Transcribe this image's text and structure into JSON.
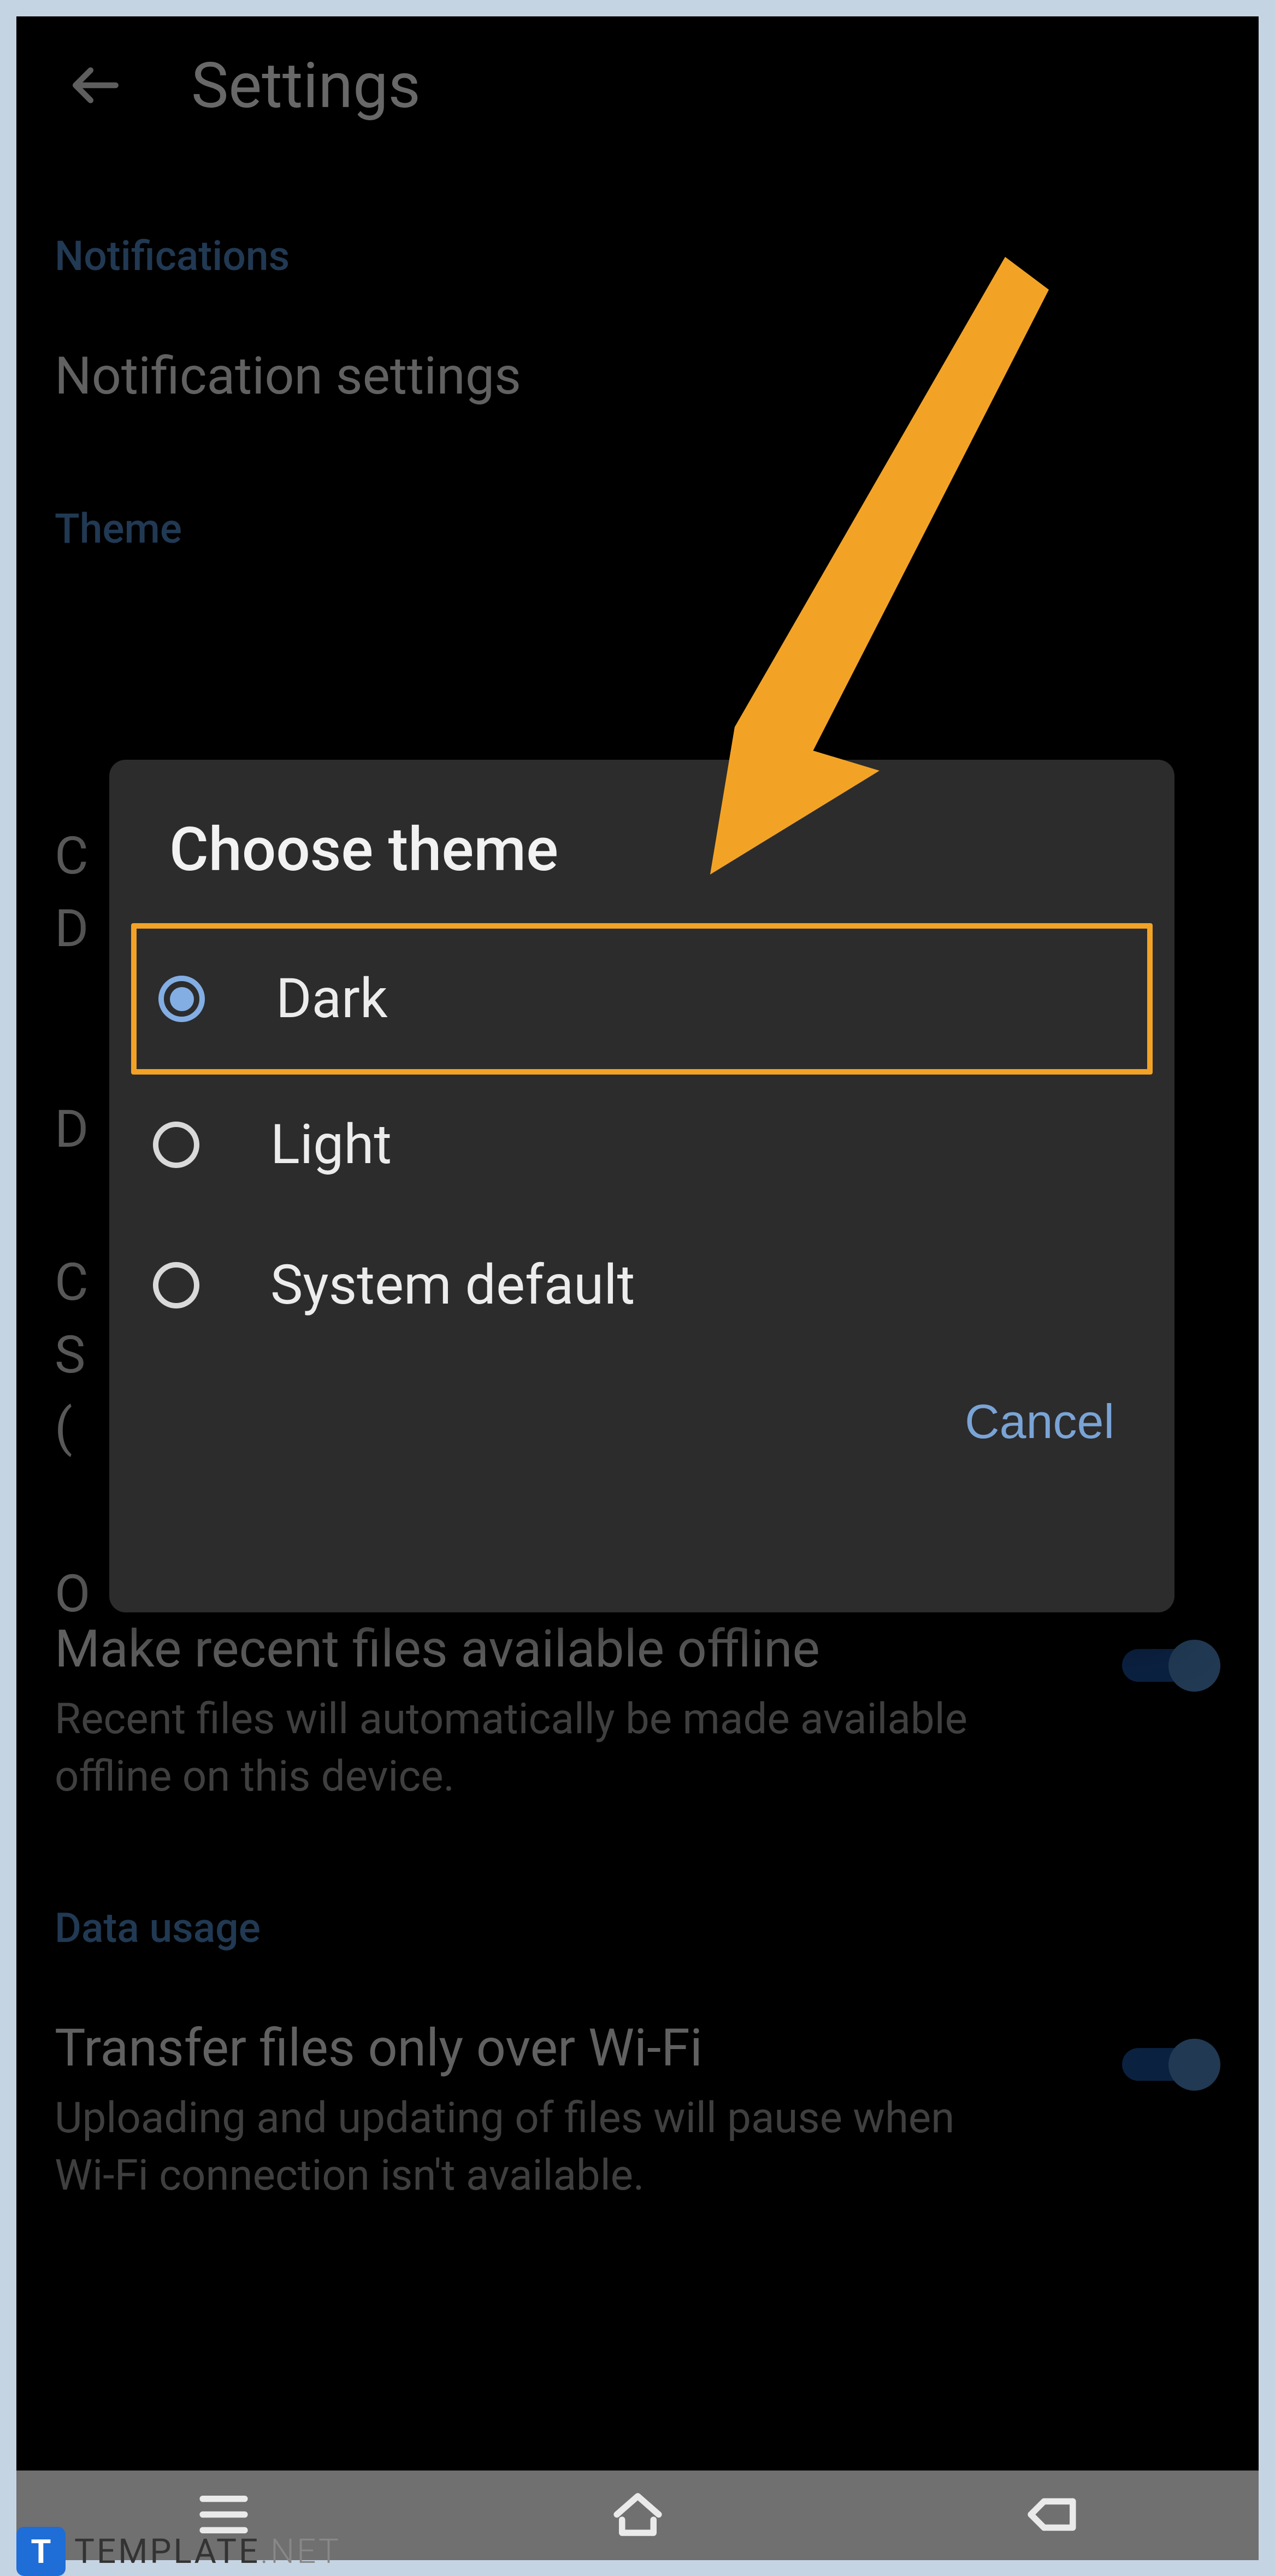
{
  "header": {
    "title": "Settings"
  },
  "sections": {
    "notifications": {
      "label": "Notifications",
      "row1": "Notification settings"
    },
    "theme": {
      "label": "Theme"
    },
    "offline": {
      "title": "Make recent files available offline",
      "sub": "Recent files will automatically be made available offline on this device."
    },
    "data": {
      "label": "Data usage",
      "title": "Transfer files only over Wi-Fi",
      "sub": "Uploading and updating of files will pause when Wi-Fi connection isn't available."
    }
  },
  "bg": {
    "c1": "C",
    "d1": "D",
    "d2": "D",
    "c3": "C",
    "s3": "S",
    "p3": "(",
    "o4": "O"
  },
  "dialog": {
    "title": "Choose theme",
    "options": [
      {
        "label": "Dark"
      },
      {
        "label": "Light"
      },
      {
        "label": "System default"
      }
    ],
    "cancel": "Cancel"
  },
  "watermark": {
    "badge": "T",
    "brand": "TEMPLATE",
    "suffix": ".NET"
  }
}
